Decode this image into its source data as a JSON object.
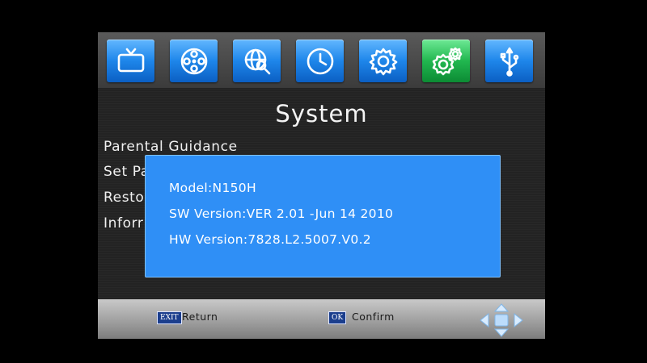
{
  "top_icons": [
    {
      "name": "tv-icon",
      "active": false
    },
    {
      "name": "film-reel-icon",
      "active": false
    },
    {
      "name": "globe-search-icon",
      "active": false
    },
    {
      "name": "clock-icon",
      "active": false
    },
    {
      "name": "gear-icon",
      "active": false
    },
    {
      "name": "gears-system-icon",
      "active": true
    },
    {
      "name": "usb-icon",
      "active": false
    }
  ],
  "page_title": "System",
  "menu_items": [
    "Parental Guidance",
    "Set Pa",
    "Resto",
    "Inforr"
  ],
  "info_popup": {
    "model": "Model:N150H",
    "sw_version": "SW Version:VER 2.01 -Jun 14 2010",
    "hw_version": "HW Version:7828.L2.5007.V0.2"
  },
  "bottom_bar": {
    "exit_key": "EXIT",
    "exit_label": "Return",
    "ok_key": "OK",
    "ok_label": "Confirm"
  },
  "colors": {
    "tile_blue": "#1e86ea",
    "tile_active_green": "#21b74f",
    "popup_blue": "#2f8ff6",
    "screen_bg": "#232323"
  }
}
